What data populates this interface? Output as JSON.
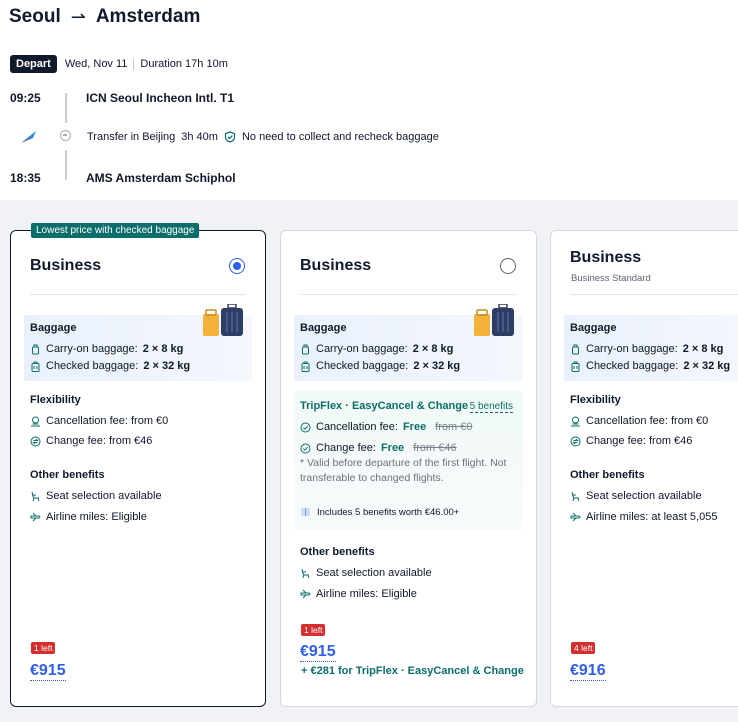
{
  "header": {
    "origin": "Seoul",
    "arrow": "⇀",
    "destination": "Amsterdam"
  },
  "depart": {
    "badge": "Depart",
    "date": "Wed, Nov 11",
    "duration": "Duration 17h 10m"
  },
  "itinerary": {
    "dep_time": "09:25",
    "dep_airport": "ICN Seoul Incheon Intl. T1",
    "transfer_city": "Transfer in Beijing",
    "transfer_time": "3h 40m",
    "transfer_note": "No need to collect and recheck baggage",
    "arr_time": "18:35",
    "arr_airport": "AMS Amsterdam Schiphol"
  },
  "cards": [
    {
      "tag": "Lowest price with checked baggage",
      "title": "Business",
      "baggage_title": "Baggage",
      "carry_label": "Carry-on baggage:",
      "carry_value": "2 × 8 kg",
      "checked_label": "Checked baggage:",
      "checked_value": "2 × 32 kg",
      "flex_title": "Flexibility",
      "cancel": "Cancellation fee: from €0",
      "change": "Change fee: from €46",
      "other_title": "Other benefits",
      "seat": "Seat selection available",
      "miles": "Airline miles: Eligible",
      "left": "1 left",
      "price": "€915"
    },
    {
      "title": "Business",
      "baggage_title": "Baggage",
      "carry_label": "Carry-on baggage:",
      "carry_value": "2 × 8 kg",
      "checked_label": "Checked baggage:",
      "checked_value": "2 × 32 kg",
      "tf_title": "TripFlex · EasyCancel & Change",
      "tf_link": "5 benefits",
      "cancel_label": "Cancellation fee:",
      "cancel_free": "Free",
      "cancel_strike": "from €0",
      "change_label": "Change fee:",
      "change_free": "Free",
      "change_strike": "from €46",
      "note": "* Valid before departure of the first flight. Not transferable to changed flights.",
      "includes": "Includes 5 benefits worth €46.00+",
      "other_title": "Other benefits",
      "seat": "Seat selection available",
      "miles": "Airline miles: Eligible",
      "left": "1 left",
      "price": "€915",
      "tf_price": "+ €281 for TripFlex · EasyCancel & Change"
    },
    {
      "title": "Business",
      "subtitle": "Business Standard",
      "baggage_title": "Baggage",
      "carry_label": "Carry-on baggage:",
      "carry_value": "2 × 8 kg",
      "checked_label": "Checked baggage:",
      "checked_value": "2 × 32 kg",
      "flex_title": "Flexibility",
      "cancel": "Cancellation fee: from €0",
      "change": "Change fee: from €46",
      "other_title": "Other benefits",
      "seat": "Seat selection available",
      "miles": "Airline miles: at least 5,055",
      "left": "4 left",
      "price": "€916"
    }
  ],
  "colors": {
    "navy": "#0f1b2d",
    "accent_blue": "#2f5ee8",
    "teal": "#0b6e6a",
    "badge_red": "#d32f2f"
  },
  "icons": [
    "plane-logo-icon",
    "shield-check-icon",
    "carry-on-icon",
    "checked-bag-icon",
    "cancel-fee-icon",
    "change-fee-icon",
    "seat-icon",
    "miles-icon",
    "check-circle-icon",
    "gift-icon",
    "luggage-illustration"
  ]
}
